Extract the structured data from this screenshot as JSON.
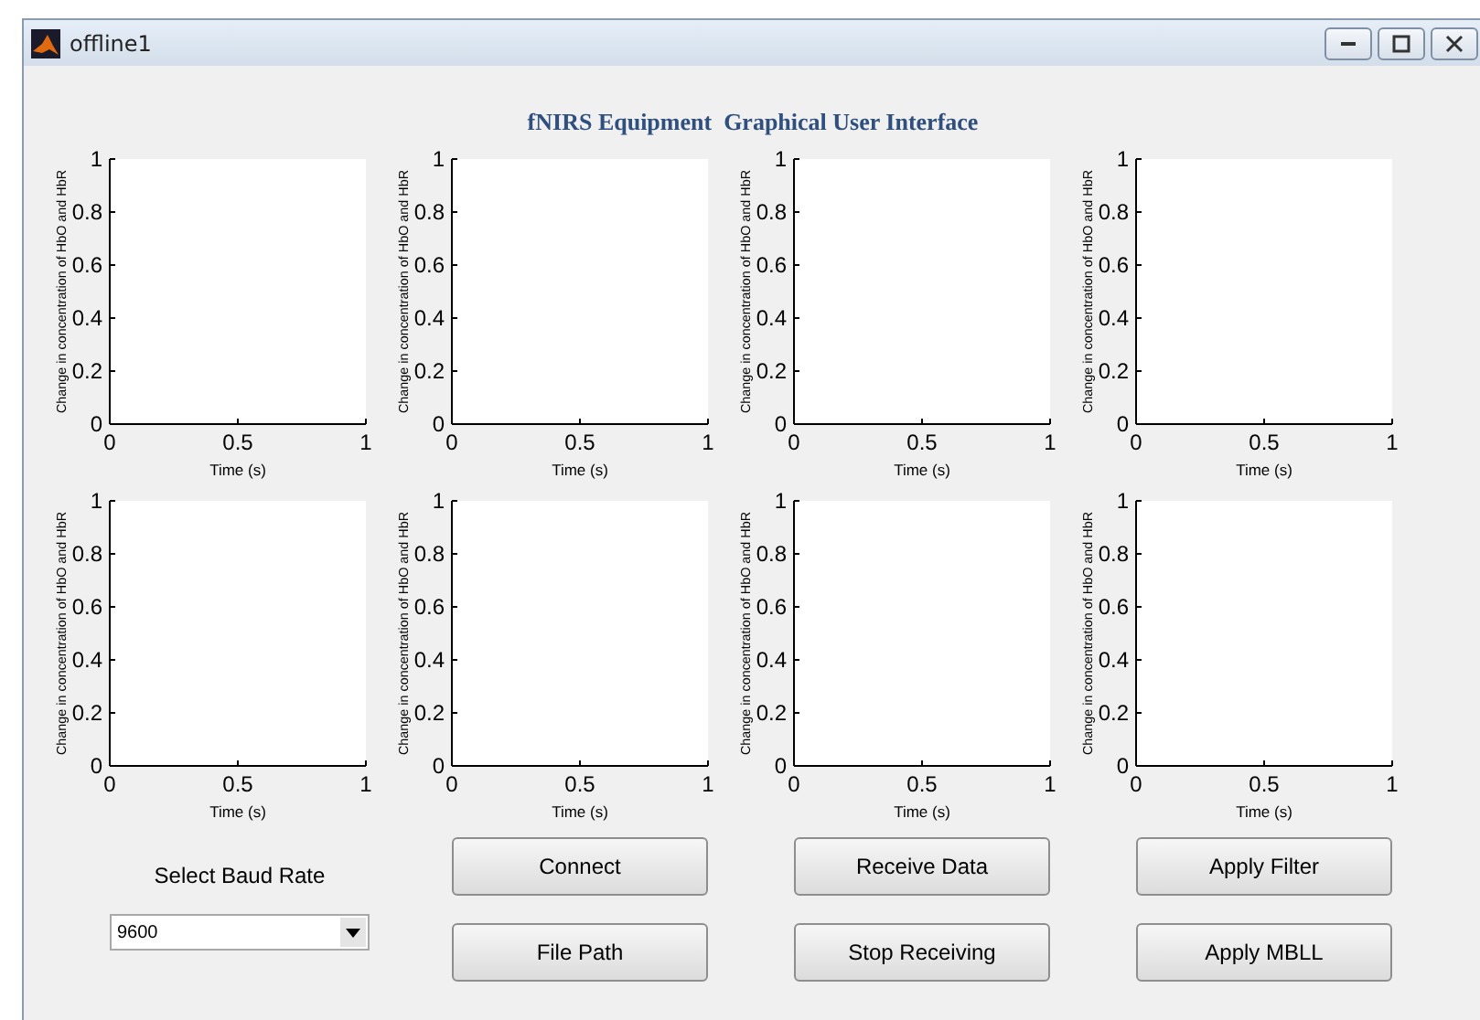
{
  "window": {
    "title": "offline1"
  },
  "header": "fNIRS Equipment  Graphical User Interface",
  "plots": [
    {
      "chart_data": {
        "type": "line",
        "xlabel": "Time (s)",
        "ylabel": "Change in concentration of HbO and HbR",
        "xlim": [
          0,
          1
        ],
        "ylim": [
          0,
          1
        ],
        "xticks": [
          0,
          0.5,
          1
        ],
        "yticks": [
          0,
          0.2,
          0.4,
          0.6,
          0.8,
          1
        ]
      }
    },
    {
      "chart_data": {
        "type": "line",
        "xlabel": "Time (s)",
        "ylabel": "Change in concentration of HbO and HbR",
        "xlim": [
          0,
          1
        ],
        "ylim": [
          0,
          1
        ],
        "xticks": [
          0,
          0.5,
          1
        ],
        "yticks": [
          0,
          0.2,
          0.4,
          0.6,
          0.8,
          1
        ]
      }
    },
    {
      "chart_data": {
        "type": "line",
        "xlabel": "Time (s)",
        "ylabel": "Change in concentration of HbO and HbR",
        "xlim": [
          0,
          1
        ],
        "ylim": [
          0,
          1
        ],
        "xticks": [
          0,
          0.5,
          1
        ],
        "yticks": [
          0,
          0.2,
          0.4,
          0.6,
          0.8,
          1
        ]
      }
    },
    {
      "chart_data": {
        "type": "line",
        "xlabel": "Time (s)",
        "ylabel": "Change in concentration of HbO and HbR",
        "xlim": [
          0,
          1
        ],
        "ylim": [
          0,
          1
        ],
        "xticks": [
          0,
          0.5,
          1
        ],
        "yticks": [
          0,
          0.2,
          0.4,
          0.6,
          0.8,
          1
        ]
      }
    },
    {
      "chart_data": {
        "type": "line",
        "xlabel": "Time (s)",
        "ylabel": "Change in concentration of HbO and HbR",
        "xlim": [
          0,
          1
        ],
        "ylim": [
          0,
          1
        ],
        "xticks": [
          0,
          0.5,
          1
        ],
        "yticks": [
          0,
          0.2,
          0.4,
          0.6,
          0.8,
          1
        ]
      }
    },
    {
      "chart_data": {
        "type": "line",
        "xlabel": "Time (s)",
        "ylabel": "Change in concentration of HbO and HbR",
        "xlim": [
          0,
          1
        ],
        "ylim": [
          0,
          1
        ],
        "xticks": [
          0,
          0.5,
          1
        ],
        "yticks": [
          0,
          0.2,
          0.4,
          0.6,
          0.8,
          1
        ]
      }
    },
    {
      "chart_data": {
        "type": "line",
        "xlabel": "Time (s)",
        "ylabel": "Change in concentration of HbO and HbR",
        "xlim": [
          0,
          1
        ],
        "ylim": [
          0,
          1
        ],
        "xticks": [
          0,
          0.5,
          1
        ],
        "yticks": [
          0,
          0.2,
          0.4,
          0.6,
          0.8,
          1
        ]
      }
    },
    {
      "chart_data": {
        "type": "line",
        "xlabel": "Time (s)",
        "ylabel": "Change in concentration of HbO and HbR",
        "xlim": [
          0,
          1
        ],
        "ylim": [
          0,
          1
        ],
        "xticks": [
          0,
          0.5,
          1
        ],
        "yticks": [
          0,
          0.2,
          0.4,
          0.6,
          0.8,
          1
        ]
      }
    }
  ],
  "baud_rate": {
    "label": "Select Baud Rate",
    "value": "9600"
  },
  "buttons": [
    [
      "Connect",
      "File Path"
    ],
    [
      "Receive Data",
      "Stop Receiving"
    ],
    [
      "Apply Filter",
      "Apply MBLL"
    ]
  ]
}
